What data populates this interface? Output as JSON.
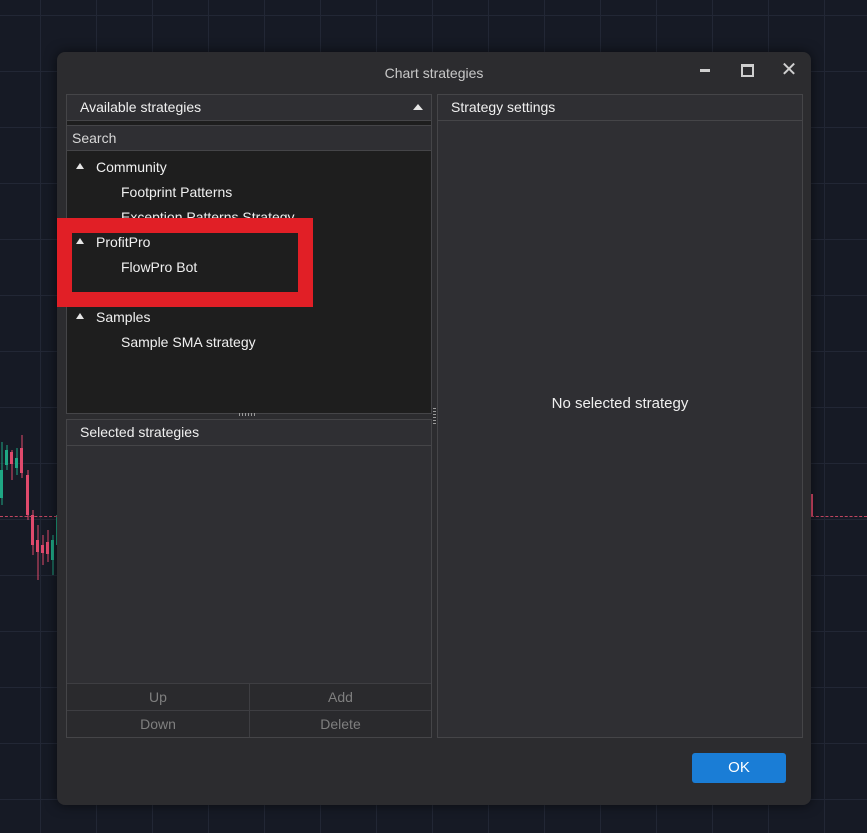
{
  "dialog": {
    "title": "Chart strategies",
    "close_glyph": "✕"
  },
  "available": {
    "header": "Available strategies",
    "search_placeholder": "Search",
    "groups": [
      {
        "name": "Community",
        "items": [
          "Footprint Patterns",
          "Exception Patterns Strategy"
        ]
      },
      {
        "name": "ProfitPro",
        "items": [
          "FlowPro Bot"
        ]
      },
      {
        "name": "Samples",
        "items": [
          "Sample SMA strategy"
        ]
      }
    ]
  },
  "selected": {
    "header": "Selected strategies",
    "buttons": {
      "up": "Up",
      "add": "Add",
      "down": "Down",
      "delete": "Delete"
    }
  },
  "settings": {
    "header": "Strategy settings",
    "empty_message": "No selected strategy"
  },
  "ok_label": "OK",
  "colors": {
    "accent": "#1a7dd6",
    "highlight_box": "#e11f26",
    "background": "#161a25",
    "dialog": "#2c2c2f"
  }
}
